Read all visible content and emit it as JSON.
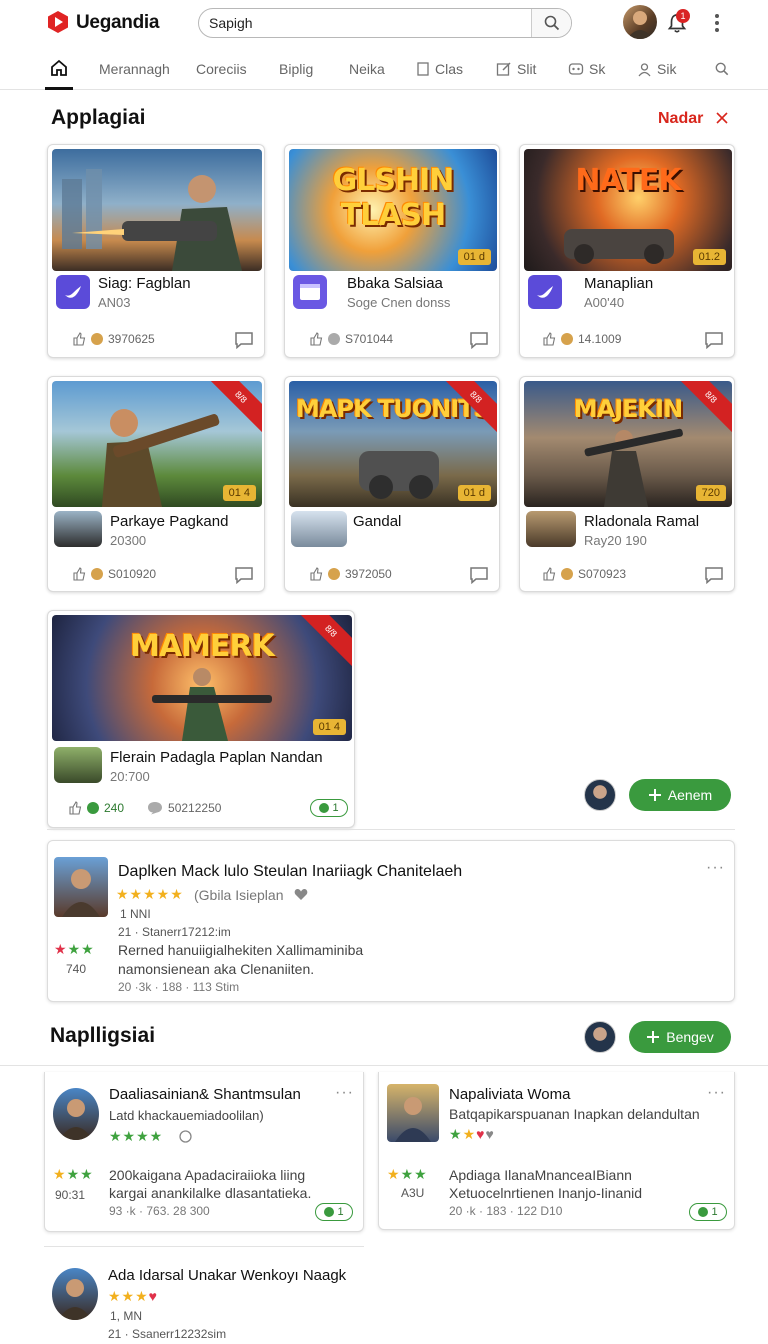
{
  "header": {
    "brand": "Uegandia",
    "search_value": "Sapigh",
    "notification_count": "1"
  },
  "tabs": [
    "Merannagh",
    "Coreciis",
    "Biplig",
    "Neika",
    "Clas",
    "Slit",
    "Sk",
    "Sik"
  ],
  "section1": {
    "title": "Applagiai",
    "action": "Nadar"
  },
  "cards": [
    {
      "name": "Siag: Fagblan",
      "sub": "AN03",
      "likes": "3970625",
      "badge": "",
      "thumb_title": "",
      "corner": ""
    },
    {
      "name": "Bbaka Salsiaa",
      "sub": "Soge Cnen donss",
      "likes": "S701044",
      "badge": "01 d",
      "thumb_title": "GLSHIN TLASH",
      "corner": ""
    },
    {
      "name": "Manaplian",
      "sub": "A00'40",
      "likes": "14.1009",
      "badge": "01.2",
      "thumb_title": "NATEK",
      "corner": ""
    },
    {
      "name": "Parkaye Pagkand",
      "sub": "20300",
      "likes": "S010920",
      "badge": "01 4",
      "thumb_title": "",
      "corner": "8/8"
    },
    {
      "name": "Gandal",
      "sub": "",
      "likes": "3972050",
      "badge": "01 d",
      "thumb_title": "MAPK TUONITS",
      "corner": "8/8"
    },
    {
      "name": "Rladonala Ramal",
      "sub": "Ray20 190",
      "likes": "S070923",
      "badge": "720",
      "thumb_title": "MAJEKIN",
      "corner": "8/8"
    },
    {
      "name": "Flerain Padagla Paplan Nandan",
      "sub": "20:700",
      "likes": "240",
      "views": "50212250",
      "badge": "01 4",
      "thumb_title": "MAMERK",
      "corner": "8/8",
      "reply": "1"
    }
  ],
  "floating_action": "Aenem",
  "featured_comment": {
    "title": "Daplken Mack lulo Steulan Inariiagk Chanitelaeh",
    "rating_text": "(Gbila Isieplan",
    "line1": "1 NNI",
    "line2": "21 · Stanerr17212:im",
    "score": "740",
    "body1": "Rerned hanuiigialhekiten Xallimaminiba",
    "body2": "namonsienean aka Clenaniiten.",
    "meta": "20 ·3k · 188 · 113 Stim"
  },
  "section2": {
    "title": "Naplligsiai",
    "action": "Bengev"
  },
  "comments": [
    {
      "title": "Daaliasainian& Shantmsulan",
      "sub": "Latd khackauemiadoolilan)",
      "time": "90:31",
      "body1": "200kaigana Apadaciraiioka liing",
      "body2": "kargai anankilalke dlasantatieka.",
      "meta": "93 ·k · 763. 28 300",
      "reply": "1"
    },
    {
      "title": "Napaliviata Woma",
      "sub": "Batqapikarspuanan Inapkan delandultan",
      "time": "A3U",
      "body1": "Apdiaga IlanaMnanceaIBiann",
      "body2": "Xetuocelnrtienen Inanjo-Iinanid",
      "meta": "20 ·k · 183 · 122 D10",
      "reply": "1"
    },
    {
      "title": "Ada Idarsal Unakar Wenkoyı Naagk",
      "line1": "1, MN",
      "line2": "21 · Ssanerr12232sim"
    }
  ],
  "colors": {
    "accent_red": "#d8261c",
    "accent_green": "#3a9a3e",
    "star_gold": "#f2b01e"
  }
}
